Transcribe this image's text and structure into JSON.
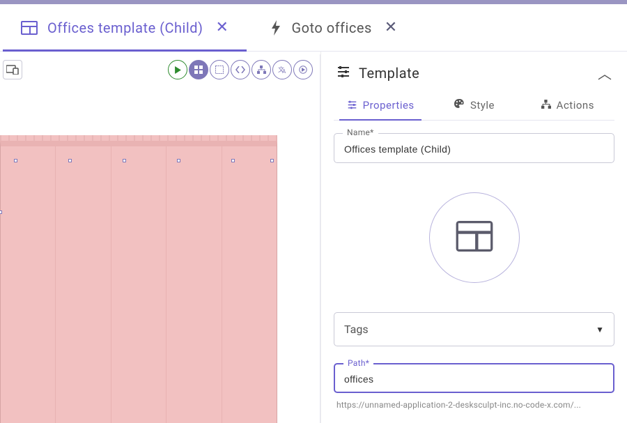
{
  "tabs": [
    {
      "label": "Offices template (Child)",
      "icon": "template",
      "active": true
    },
    {
      "label": "Goto offices",
      "icon": "bolt",
      "active": false
    }
  ],
  "panel": {
    "title": "Template",
    "subtabs": {
      "properties": "Properties",
      "style": "Style",
      "actions": "Actions"
    },
    "name_label": "Name*",
    "name_value": "Offices template (Child)",
    "tags_label": "Tags",
    "path_label": "Path*",
    "path_value": "offices",
    "hint": "https://unnamed-application-2-desksculpt-inc.no-code-x.com/..."
  },
  "colors": {
    "accent": "#6a5fcf"
  }
}
